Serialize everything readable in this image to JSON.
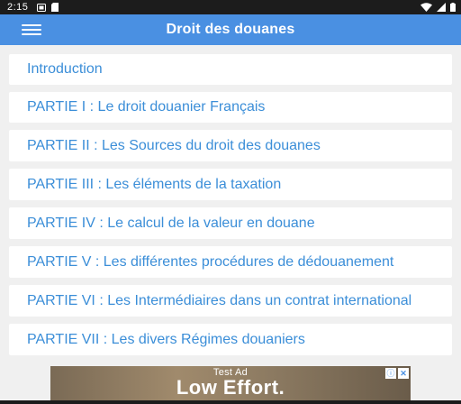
{
  "status_bar": {
    "time": "2:15",
    "icons": [
      "sim-icon",
      "sd-card-icon",
      "wifi-icon",
      "signal-icon",
      "battery-icon"
    ]
  },
  "app_bar": {
    "title": "Droit des douanes",
    "menu_icon": "menu-icon"
  },
  "chapters": [
    {
      "label": "Introduction"
    },
    {
      "label": "PARTIE I : Le droit douanier Français"
    },
    {
      "label": "PARTIE II : Les Sources du droit des douanes"
    },
    {
      "label": "PARTIE III : Les éléments de la taxation"
    },
    {
      "label": "PARTIE IV : Le calcul de la valeur en douane"
    },
    {
      "label": "PARTIE V : Les différentes procédures de dédouanement"
    },
    {
      "label": "PARTIE VI : Les Intermédiaires dans un contrat international"
    },
    {
      "label": "PARTIE VII : Les divers Régimes douaniers"
    }
  ],
  "ad": {
    "label": "Test Ad",
    "headline": "Low Effort.",
    "choices_icon": "info-icon",
    "close_icon": "close-icon"
  },
  "colors": {
    "app_bar": "#4a90e2",
    "link_text": "#3b8ed8",
    "background": "#f0f0f0"
  }
}
